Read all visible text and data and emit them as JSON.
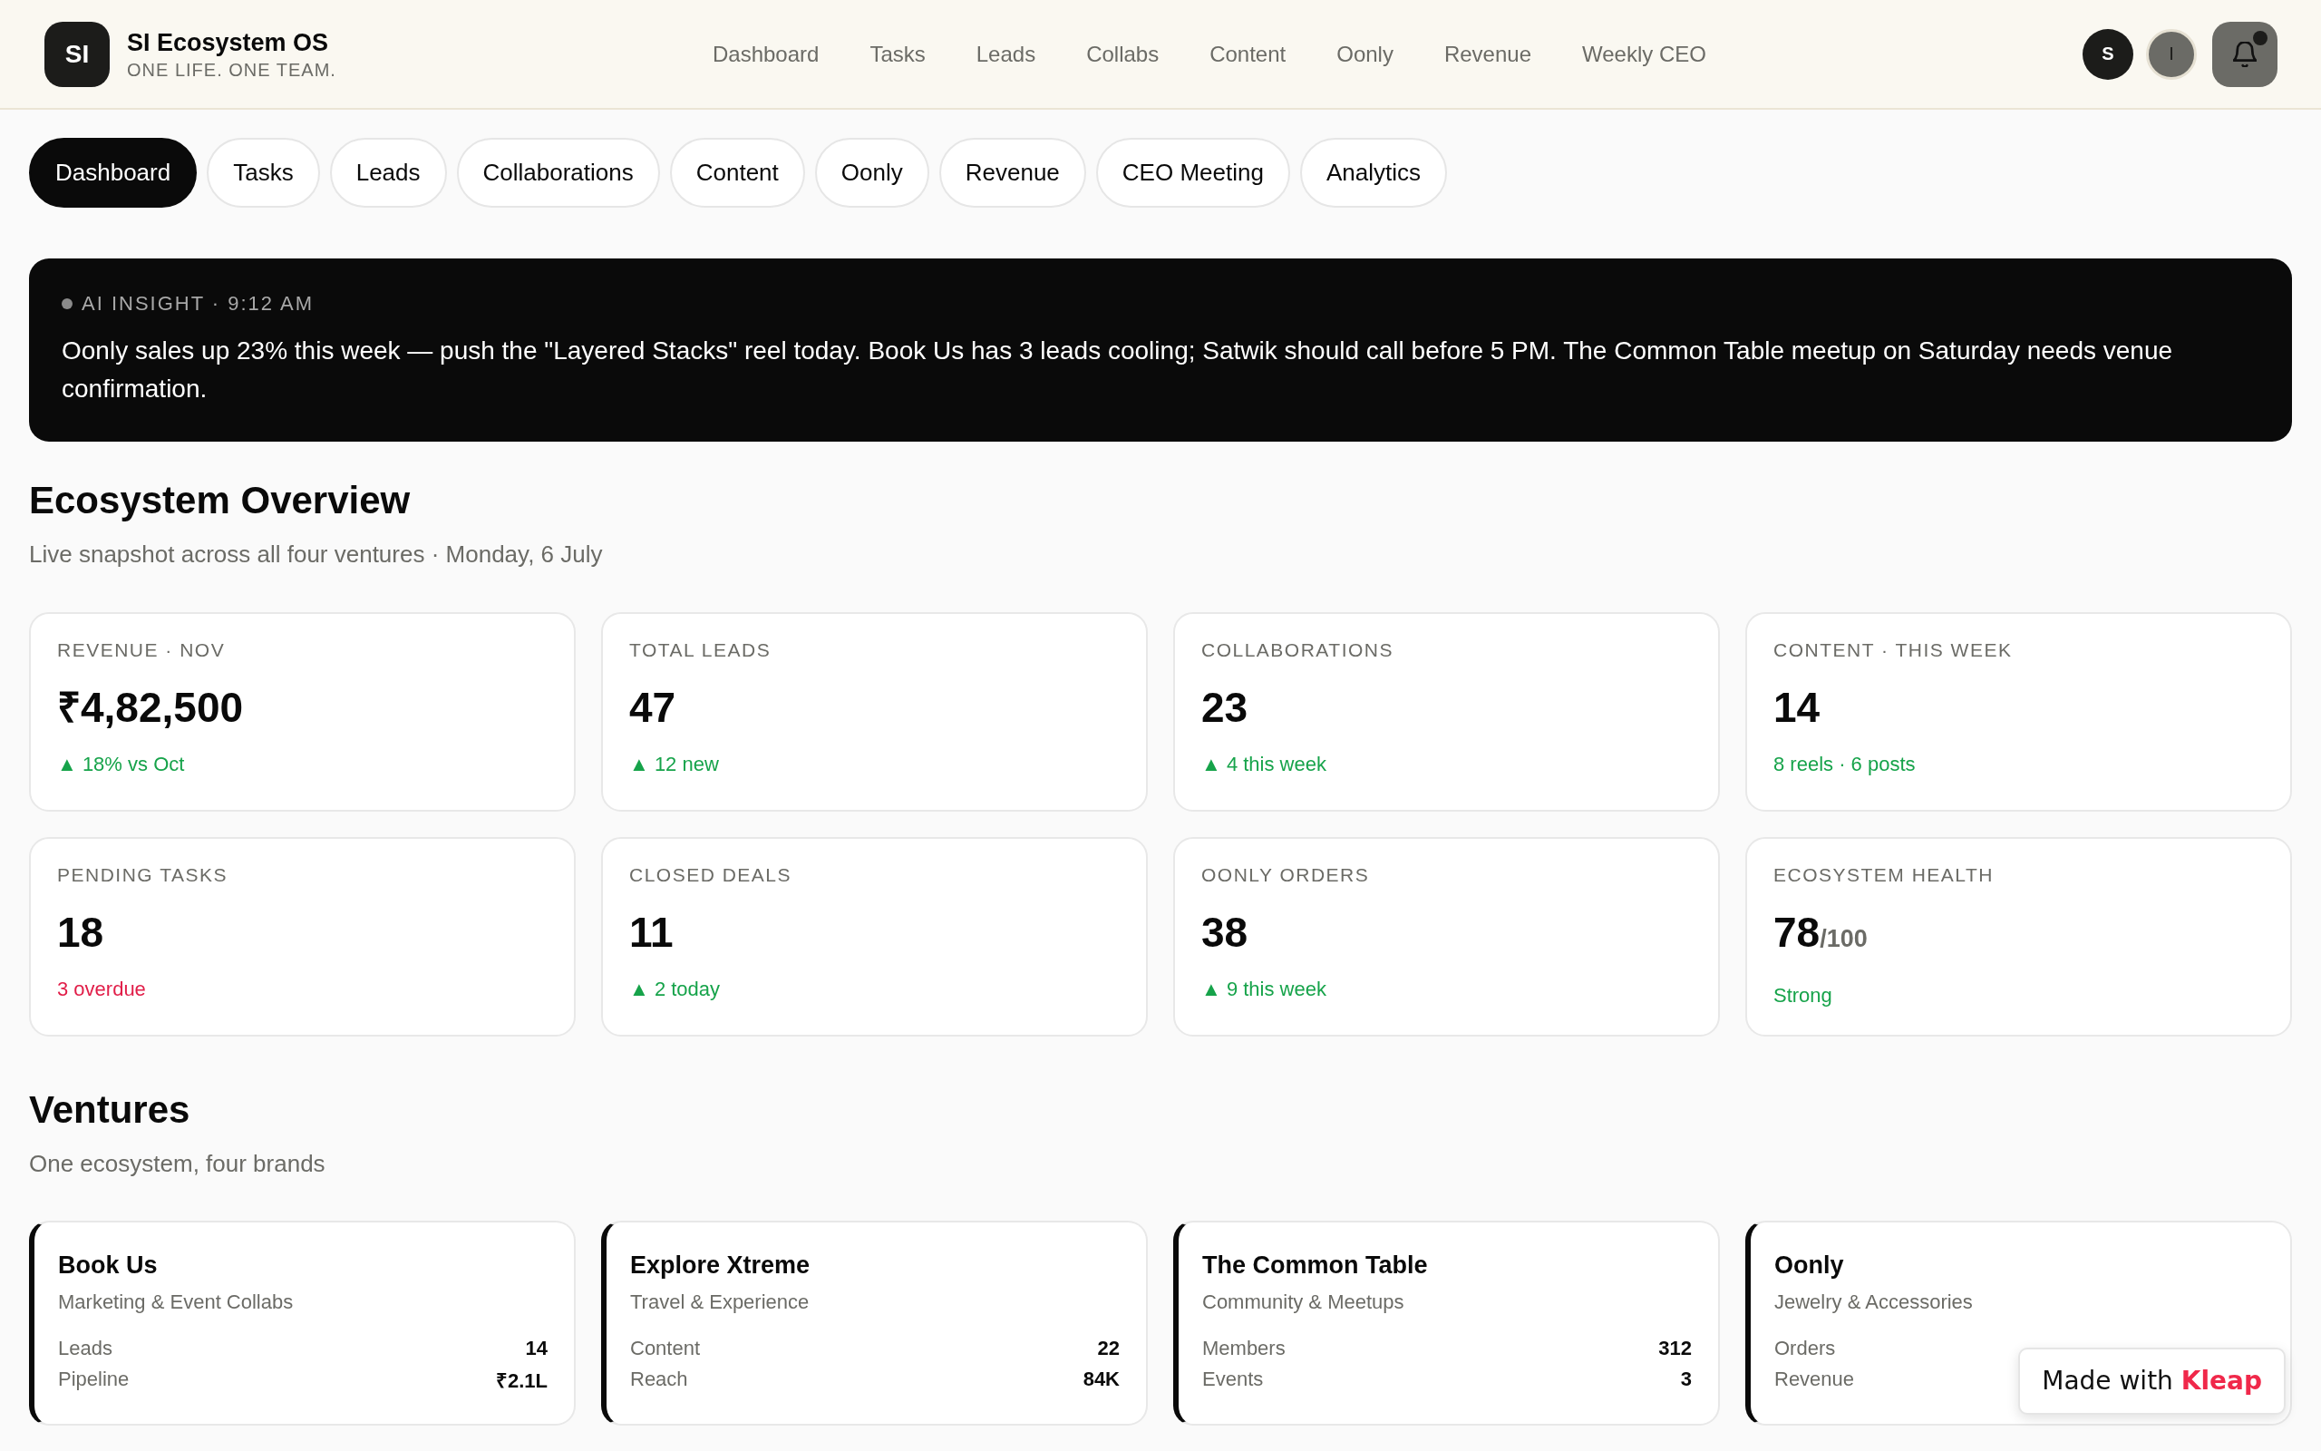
{
  "header": {
    "logo": "SI",
    "title": "SI Ecosystem OS",
    "tagline": "ONE LIFE. ONE TEAM.",
    "nav": [
      "Dashboard",
      "Tasks",
      "Leads",
      "Collabs",
      "Content",
      "Oonly",
      "Revenue",
      "Weekly CEO"
    ],
    "avatars": [
      {
        "initial": "S",
        "kind": "dark"
      },
      {
        "initial": "I",
        "kind": "muted"
      }
    ],
    "notifications": {
      "unread": true
    }
  },
  "tabs": [
    {
      "label": "Dashboard",
      "selected": true
    },
    {
      "label": "Tasks",
      "selected": false
    },
    {
      "label": "Leads",
      "selected": false
    },
    {
      "label": "Collaborations",
      "selected": false
    },
    {
      "label": "Content",
      "selected": false
    },
    {
      "label": "Oonly",
      "selected": false
    },
    {
      "label": "Revenue",
      "selected": false
    },
    {
      "label": "CEO Meeting",
      "selected": false
    },
    {
      "label": "Analytics",
      "selected": false
    }
  ],
  "insight": {
    "label": "AI INSIGHT · 9:12 AM",
    "text": "Oonly sales up 23% this week — push the \"Layered Stacks\" reel today. Book Us has 3 leads cooling; Satwik should call before 5 PM. The Common Table meetup on Saturday needs venue confirmation."
  },
  "overview": {
    "title": "Ecosystem Overview",
    "subtitle": "Live snapshot across all four ventures · Monday, 6 July",
    "stats": [
      {
        "label": "REVENUE · NOV",
        "value": "₹4,82,500",
        "note": "▲ 18% vs Oct",
        "kind": "positive"
      },
      {
        "label": "TOTAL LEADS",
        "value": "47",
        "note": "▲ 12 new",
        "kind": "positive"
      },
      {
        "label": "COLLABORATIONS",
        "value": "23",
        "note": "▲ 4 this week",
        "kind": "positive"
      },
      {
        "label": "CONTENT · THIS WEEK",
        "value": "14",
        "note": "8 reels · 6 posts",
        "kind": "positive"
      },
      {
        "label": "PENDING TASKS",
        "value": "18",
        "note": "3 overdue",
        "kind": "negative"
      },
      {
        "label": "CLOSED DEALS",
        "value": "11",
        "note": "▲ 2 today",
        "kind": "positive"
      },
      {
        "label": "OONLY ORDERS",
        "value": "38",
        "note": "▲ 9 this week",
        "kind": "positive"
      },
      {
        "label": "ECOSYSTEM HEALTH",
        "value": "78",
        "suffix": "/100",
        "note": "Strong",
        "kind": "positive"
      }
    ]
  },
  "ventures": {
    "title": "Ventures",
    "subtitle": "One ecosystem, four brands",
    "cards": [
      {
        "name": "Book Us",
        "category": "Marketing & Event Collabs",
        "metrics": [
          {
            "label": "Leads",
            "value": "14"
          },
          {
            "label": "Pipeline",
            "value": "₹2.1L"
          }
        ]
      },
      {
        "name": "Explore Xtreme",
        "category": "Travel & Experience",
        "metrics": [
          {
            "label": "Content",
            "value": "22"
          },
          {
            "label": "Reach",
            "value": "84K"
          }
        ]
      },
      {
        "name": "The Common Table",
        "category": "Community & Meetups",
        "metrics": [
          {
            "label": "Members",
            "value": "312"
          },
          {
            "label": "Events",
            "value": "3"
          }
        ]
      },
      {
        "name": "Oonly",
        "category": "Jewelry & Accessories",
        "metrics": [
          {
            "label": "Orders"
          },
          {
            "label": "Revenue"
          }
        ]
      }
    ]
  },
  "badge": {
    "text": "Made with **Kleap**"
  }
}
